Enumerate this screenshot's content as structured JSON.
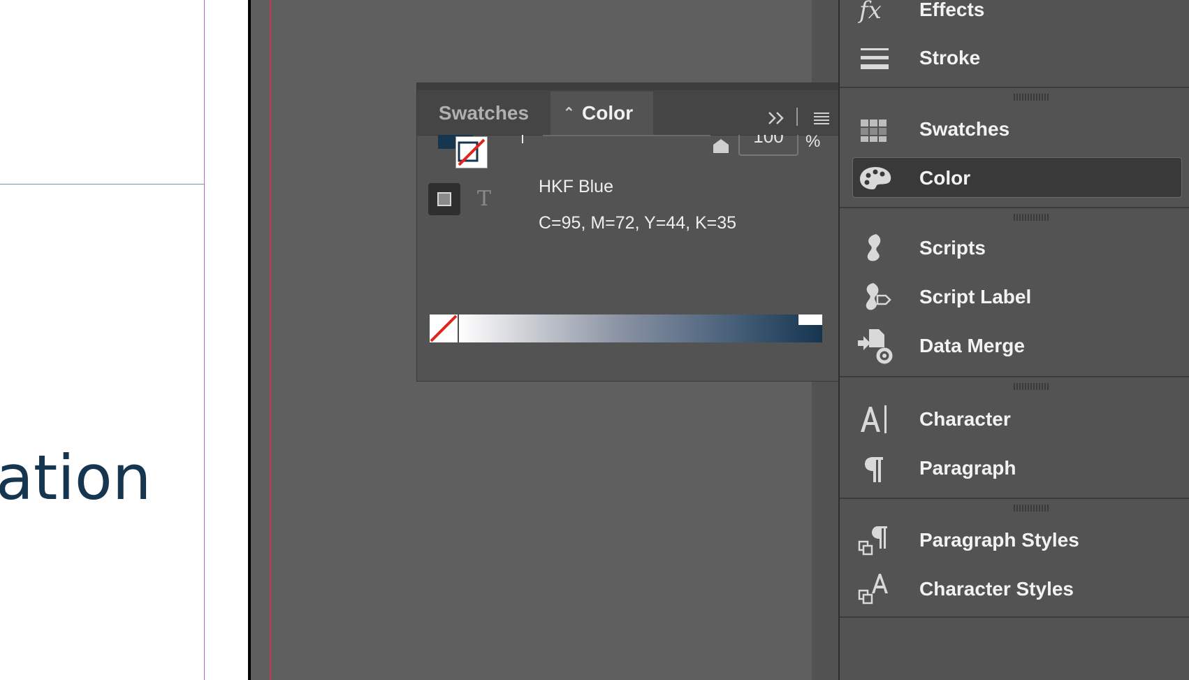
{
  "document": {
    "visible_text": "ation"
  },
  "color_panel": {
    "tabs": [
      {
        "label": "Swatches"
      },
      {
        "label": "Color"
      }
    ],
    "tint_value": "100",
    "tint_unit": "%",
    "color_name": "HKF Blue",
    "color_values": "C=95, M=72, Y=44, K=35",
    "formatting_text_glyph": "T",
    "collapse_glyph": ">>",
    "fill_color": "#16354f"
  },
  "dock": {
    "items": [
      {
        "label": "Effects",
        "icon": "fx-icon"
      },
      {
        "label": "Stroke",
        "icon": "stroke-icon"
      },
      {
        "label": "Swatches",
        "icon": "swatches-icon"
      },
      {
        "label": "Color",
        "icon": "palette-icon",
        "selected": true
      },
      {
        "label": "Scripts",
        "icon": "scripts-icon"
      },
      {
        "label": "Script Label",
        "icon": "script-label-icon"
      },
      {
        "label": "Data Merge",
        "icon": "data-merge-icon"
      },
      {
        "label": "Character",
        "icon": "character-icon"
      },
      {
        "label": "Paragraph",
        "icon": "paragraph-icon"
      },
      {
        "label": "Paragraph Styles",
        "icon": "paragraph-styles-icon"
      },
      {
        "label": "Character Styles",
        "icon": "character-styles-icon"
      }
    ]
  }
}
